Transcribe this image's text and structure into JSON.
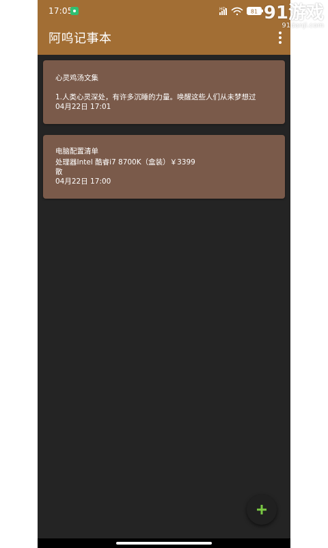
{
  "status_bar": {
    "time": "17:05",
    "app_icon": "notification-app-icon",
    "icons": [
      "hd-icon",
      "signal-icon",
      "wifi-icon",
      "battery-icon"
    ],
    "battery": "81"
  },
  "app_bar": {
    "title": "阿呜记事本",
    "menu_icon": "more-vert-icon",
    "background": "#a26e34"
  },
  "watermark": {
    "text": "91游戏",
    "site": "91danji.com"
  },
  "notes": [
    {
      "title": "心灵鸡汤文集",
      "body_lines": [
        "1.人类心灵深处，有许多沉睡的力量。唤醒这些人们从未梦想过"
      ],
      "date": "04月22日 17:01"
    },
    {
      "title": "电脑配置清单",
      "body_lines": [
        "处理器Intel 酷睿i7 8700K（盒装）￥3399",
        "散"
      ],
      "date": "04月22日 17:00"
    }
  ],
  "fab": {
    "icon": "add-icon",
    "color": "#7ac943"
  },
  "colors": {
    "background": "#242424",
    "card": "#7a5a4a",
    "text": "#ffffff"
  }
}
